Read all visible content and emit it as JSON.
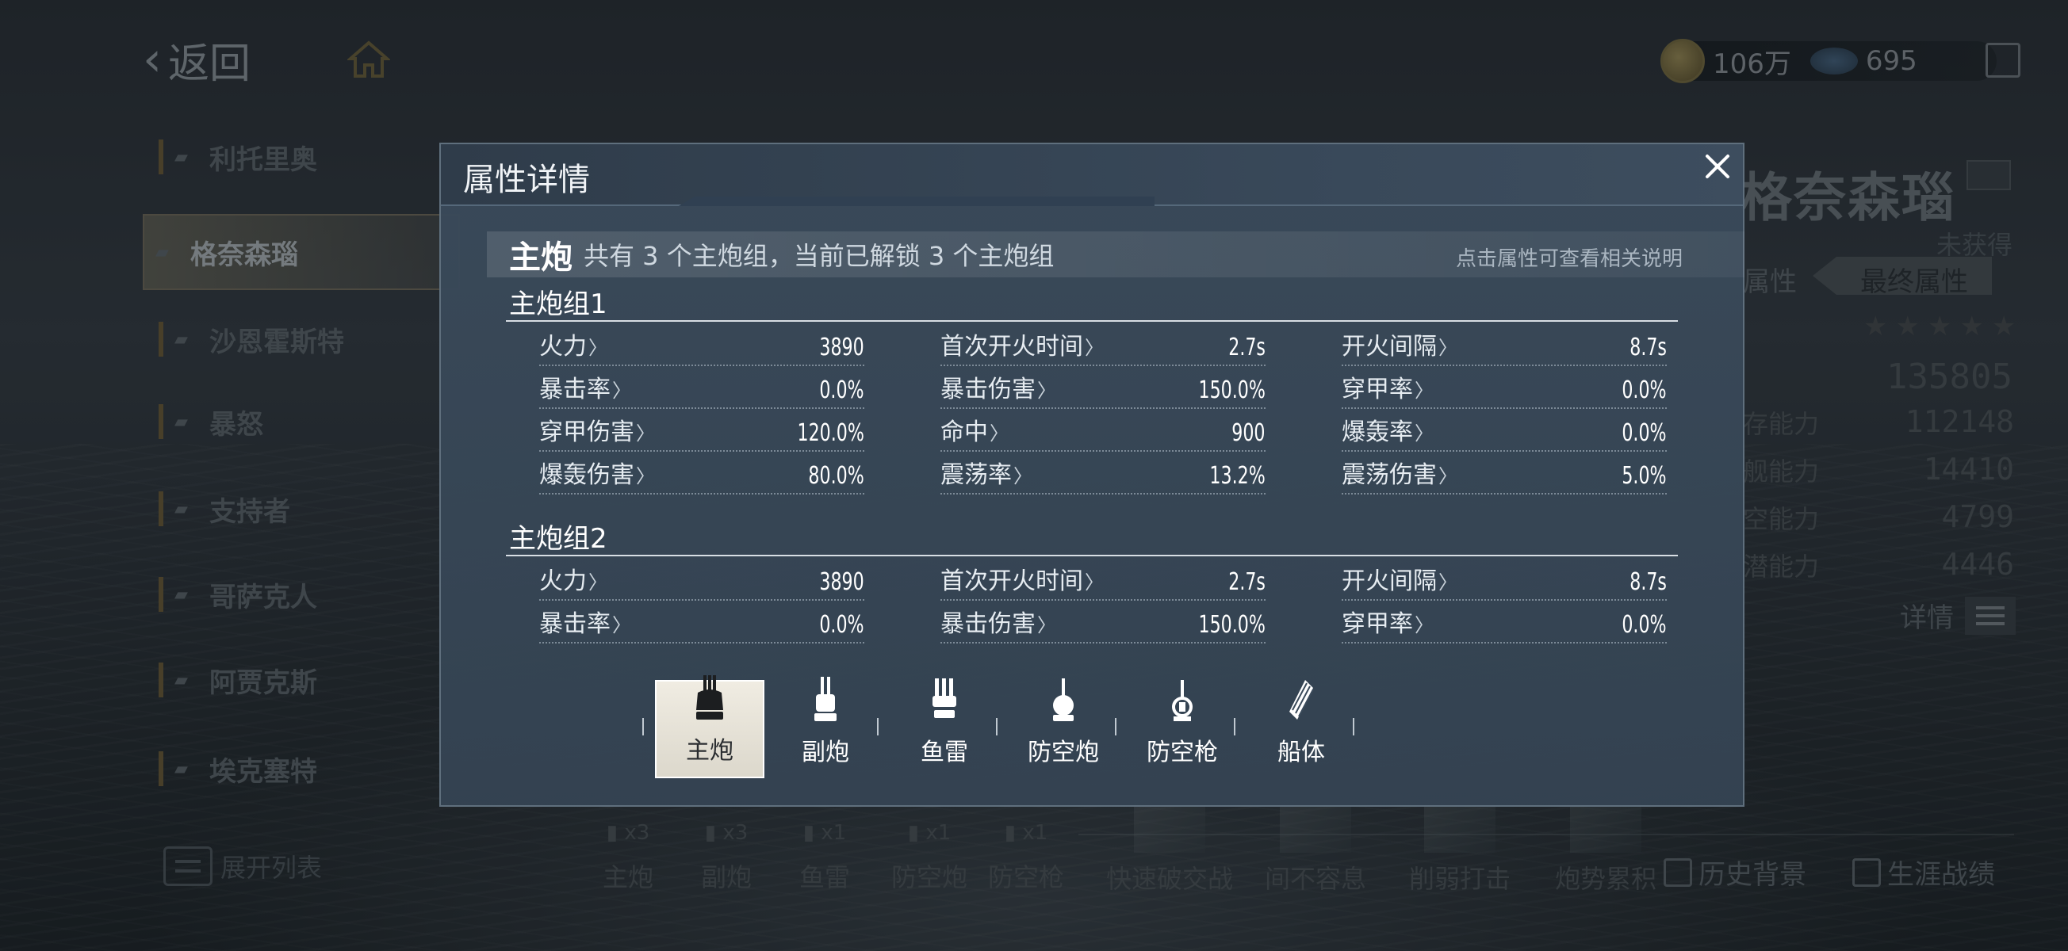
{
  "topbar": {
    "back_label": "返回",
    "coins": "106万",
    "gems": "695"
  },
  "ship_list": {
    "items": [
      {
        "name": "利托里奥",
        "active": false
      },
      {
        "name": "格奈森瑙",
        "active": true
      },
      {
        "name": "沙恩霍斯特",
        "active": false
      },
      {
        "name": "暴怒",
        "active": false
      },
      {
        "name": "支持者",
        "active": false
      },
      {
        "name": "哥萨克人",
        "active": false
      },
      {
        "name": "阿贾克斯",
        "active": false
      },
      {
        "name": "埃克塞特",
        "active": false
      }
    ],
    "expand_label": "展开列表"
  },
  "ship_panel": {
    "name": "格奈森瑙",
    "status": "未获得",
    "tab_attr": "属性",
    "tab_final": "最终属性",
    "stars": "★★★★★",
    "power": "135805",
    "stats": [
      {
        "label": "存能力",
        "value": "112148"
      },
      {
        "label": "舰能力",
        "value": "14410"
      },
      {
        "label": "空能力",
        "value": "4799"
      },
      {
        "label": "潜能力",
        "value": "4446"
      }
    ],
    "detail_label": "详情",
    "history_label": "历史背景",
    "career_label": "生涯战绩"
  },
  "dock": {
    "weapons": [
      {
        "label": "主炮",
        "count": "x3"
      },
      {
        "label": "副炮",
        "count": "x3"
      },
      {
        "label": "鱼雷",
        "count": "x1"
      },
      {
        "label": "防空炮",
        "count": "x1"
      },
      {
        "label": "防空枪",
        "count": "x1"
      }
    ],
    "skills": [
      "快速破交战",
      "间不容息",
      "削弱打击",
      "炮势累积"
    ]
  },
  "modal": {
    "title": "属性详情",
    "summary_main": "主炮",
    "summary_desc": "共有 3 个主炮组，当前已解锁 3 个主炮组",
    "summary_hint": "点击属性可查看相关说明",
    "groups": [
      {
        "title": "主炮组1",
        "rows": [
          [
            {
              "label": "火力",
              "value": "3890"
            },
            {
              "label": "首次开火时间",
              "value": "2.7s"
            },
            {
              "label": "开火间隔",
              "value": "8.7s"
            }
          ],
          [
            {
              "label": "暴击率",
              "value": "0.0%"
            },
            {
              "label": "暴击伤害",
              "value": "150.0%"
            },
            {
              "label": "穿甲率",
              "value": "0.0%"
            }
          ],
          [
            {
              "label": "穿甲伤害",
              "value": "120.0%"
            },
            {
              "label": "命中",
              "value": "900"
            },
            {
              "label": "爆轰率",
              "value": "0.0%"
            }
          ],
          [
            {
              "label": "爆轰伤害",
              "value": "80.0%"
            },
            {
              "label": "震荡率",
              "value": "13.2%"
            },
            {
              "label": "震荡伤害",
              "value": "5.0%"
            }
          ]
        ]
      },
      {
        "title": "主炮组2",
        "rows": [
          [
            {
              "label": "火力",
              "value": "3890"
            },
            {
              "label": "首次开火时间",
              "value": "2.7s"
            },
            {
              "label": "开火间隔",
              "value": "8.7s"
            }
          ],
          [
            {
              "label": "暴击率",
              "value": "0.0%"
            },
            {
              "label": "暴击伤害",
              "value": "150.0%"
            },
            {
              "label": "穿甲率",
              "value": "0.0%"
            }
          ]
        ]
      }
    ],
    "tabs": [
      {
        "label": "主炮",
        "icon": "main-gun-icon",
        "active": true
      },
      {
        "label": "副炮",
        "icon": "secondary-gun-icon",
        "active": false
      },
      {
        "label": "鱼雷",
        "icon": "torpedo-icon",
        "active": false
      },
      {
        "label": "防空炮",
        "icon": "aa-cannon-icon",
        "active": false
      },
      {
        "label": "防空枪",
        "icon": "aa-gun-icon",
        "active": false
      },
      {
        "label": "船体",
        "icon": "hull-icon",
        "active": false
      }
    ]
  },
  "colors": {
    "modal_bg": "#384858",
    "accent_gold": "#7a6a3f",
    "active_tab": "#ece8dd"
  }
}
